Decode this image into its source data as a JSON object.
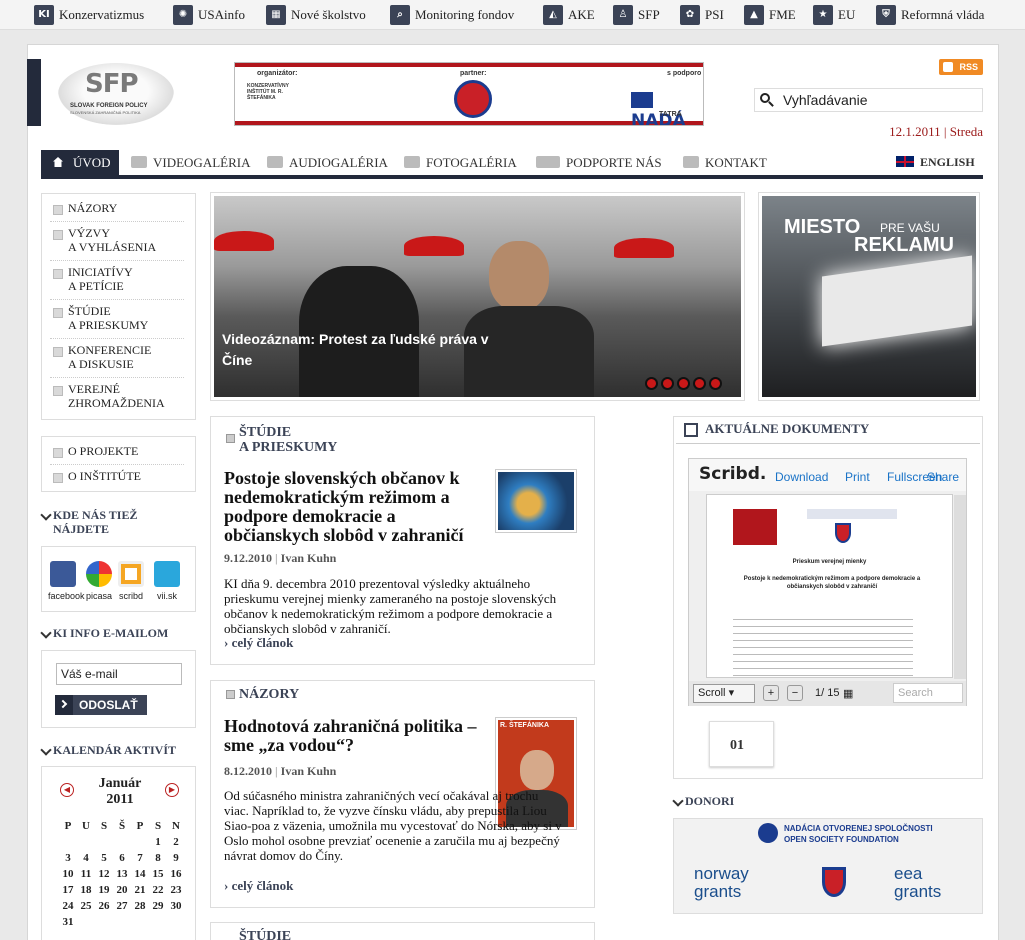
{
  "topbar": [
    {
      "icon": "ki-logo-icon",
      "label": "Konzervatizmus",
      "mark": "KI"
    },
    {
      "icon": "globe-icon",
      "label": "USAinfo",
      "mark": "✺"
    },
    {
      "icon": "school-icon",
      "label": "Nové školstvo",
      "mark": "▦"
    },
    {
      "icon": "magnifier-icon",
      "label": "Monitoring fondov",
      "mark": "⌕"
    },
    {
      "icon": "landscape-icon",
      "label": "AKE",
      "mark": "◭"
    },
    {
      "icon": "person-icon",
      "label": "SFP",
      "mark": "♙"
    },
    {
      "icon": "paw-icon",
      "label": "PSI",
      "mark": "✿"
    },
    {
      "icon": "chart-icon",
      "label": "FME",
      "mark": "▲"
    },
    {
      "icon": "star-icon",
      "label": "EU",
      "mark": "★"
    },
    {
      "icon": "shield-icon",
      "label": "Reformná vláda",
      "mark": "⛨"
    }
  ],
  "header": {
    "logo_text": "SFP",
    "logo_sub": "SLOVAK FOREIGN POLICY",
    "logo_sub2": "SLOVENSKÁ ZAHRANIČNÁ POLITIKA",
    "banner_organizer": "organizátor:",
    "banner_org_name": "KONZERVATÍVNY INŠTITÚT M. R. ŠTEFÁNIKA",
    "banner_partner": "partner:",
    "banner_support": "s podporo",
    "banner_nada": "NADÁ",
    "banner_tatra": "TATRA",
    "rss": "RSS",
    "search_placeholder": "Vyhľadávanie",
    "date": "12.1.2011",
    "day": "Streda"
  },
  "nav": {
    "home": "ÚVOD",
    "items": [
      "VIDEOGALÉRIA",
      "AUDIOGALÉRIA",
      "FOTOGALÉRIA",
      "PODPORTE NÁS",
      "KONTAKT"
    ],
    "english": "ENGLISH"
  },
  "left_menu": [
    [
      "NÁZORY"
    ],
    [
      "VÝZVY",
      "A VYHLÁSENIA"
    ],
    [
      "INICIATÍVY",
      "A PETÍCIE"
    ],
    [
      "ŠTÚDIE",
      "A PRIESKUMY"
    ],
    [
      "KONFERENCIE",
      "A DISKUSIE"
    ],
    [
      "VEREJNÉ",
      "ZHROMAŽDENIA"
    ]
  ],
  "project_menu": [
    "O PROJEKTE",
    "O INŠTITÚTE"
  ],
  "find_us": {
    "heading_1": "KDE NÁS TIEŽ",
    "heading_2": "NÁJDETE",
    "items": [
      "facebook",
      "picasa",
      "scribd",
      "vii.sk"
    ]
  },
  "newsletter": {
    "heading": "KI INFO E-MAILOM",
    "placeholder": "Váš e-mail",
    "button": "ODOSLAŤ"
  },
  "calendar": {
    "heading": "KALENDÁR AKTIVÍT",
    "month": "Január",
    "year": "2011",
    "weekdays": [
      "P",
      "U",
      "S",
      "Š",
      "P",
      "S",
      "N"
    ],
    "weeks": [
      [
        "",
        "",
        "",
        "",
        "",
        "1",
        "2"
      ],
      [
        "3",
        "4",
        "5",
        "6",
        "7",
        "8",
        "9"
      ],
      [
        "10",
        "11",
        "12",
        "13",
        "14",
        "15",
        "16"
      ],
      [
        "17",
        "18",
        "19",
        "20",
        "21",
        "22",
        "23"
      ],
      [
        "24",
        "25",
        "26",
        "27",
        "28",
        "29",
        "30"
      ],
      [
        "31",
        "",
        "",
        "",
        "",
        "",
        ""
      ]
    ]
  },
  "hero": {
    "caption": "Videozáznam: Protest za ľudské práva v Číne"
  },
  "ad": {
    "line1": "MIESTO",
    "line2": "PRE VAŠU",
    "line3": "REKLAMU"
  },
  "articles": [
    {
      "section_1": "ŠTÚDIE",
      "section_2": "A PRIESKUMY",
      "title": "Postoje slovenských občanov k nedemokratickým režimom a podpore demokracie a občianskych slobôd v zahraničí",
      "date": "9.12.2010",
      "author": "Ivan Kuhn",
      "body": "KI dňa 9. decembra 2010 prezentoval výsledky aktuálneho prieskumu verejnej mienky zameraného na postoje slovenských občanov k nedemokratickým režimom a podpore demokracie a občianskych slobôd v zahraničí.",
      "more": "celý článok"
    },
    {
      "section_1": "NÁZORY",
      "title": "Hodnotová zahraničná politika – sme „za vodou“?",
      "date": "8.12.2010",
      "author": "Ivan Kuhn",
      "body": "Od súčasného ministra zahraničných vecí očakával aj trochu viac. Napríklad to, že vyzve čínsku vládu, aby prepustila Liou Siao-poa z väzenia, umožnila mu vycestovať do Nórska, aby si v Oslo mohol osobne prevziať ocenenie a zaručila mu aj bezpečný návrat domov do Číny.",
      "more": "celý článok",
      "thumb_text": "R. ŠTEFÁNIKA"
    },
    {
      "section_1": "ŠTÚDIE"
    }
  ],
  "documents": {
    "heading": "AKTUÁLNE DOKUMENTY",
    "scribd_logo": "Scribd.",
    "download": "Download",
    "print": "Print",
    "fullscreen": "Fullscreen",
    "share": "Share",
    "doc_title": "Prieskum verejnej mienky",
    "doc_subtitle": "Postoje k nedemokratickým režimom a podpore demokracie a občianskych slobôd v zahraničí",
    "scroll": "Scroll",
    "page": "1/ 15",
    "search_placeholder": "Search",
    "doc_number": "01"
  },
  "donors": {
    "heading": "DONORI",
    "nos_1": "NADÁCIA OTVORENEJ SPOLOČNOSTI",
    "nos_2": "OPEN SOCIETY FOUNDATION",
    "norway": "norway grants",
    "eea": "eea grants"
  }
}
